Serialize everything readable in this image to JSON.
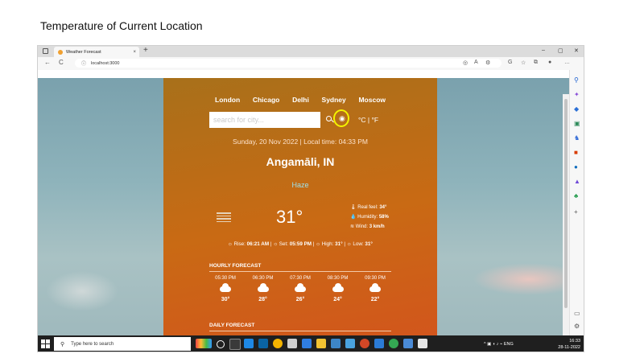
{
  "slide": {
    "title": "Temperature of Current Location"
  },
  "browser": {
    "tab_title": "Weather Forecast",
    "tab_close": "×",
    "new_tab": "+",
    "win_minimize": "–",
    "win_restore": "▢",
    "win_close": "✕",
    "url": "localhost:3000",
    "back": "←",
    "reload": "C",
    "info": "ⓘ"
  },
  "app": {
    "cities": [
      "London",
      "Chicago",
      "Delhi",
      "Sydney",
      "Moscow"
    ],
    "search_placeholder": "search for city...",
    "units": "°C | °F",
    "datetime": "Sunday, 20 Nov 2022 | Local time: 04:33 PM",
    "city": "Angamāli, IN",
    "condition": "Haze",
    "temperature": "31°",
    "details": {
      "real_feel_label": "Real feel:",
      "real_feel": "34°",
      "humidity_label": "Humidity:",
      "humidity": "58%",
      "wind_label": "Wind:",
      "wind": "3 km/h"
    },
    "sun": {
      "rise_label": "Rise:",
      "rise": "06:21 AM",
      "set_label": "Set:",
      "set": "05:59 PM",
      "high_label": "High:",
      "high": "31°",
      "low_label": "Low:",
      "low": "31°"
    },
    "hourly_title": "HOURLY FORECAST",
    "hourly": [
      {
        "time": "05:30 PM",
        "temp": "30°",
        "icon": "cloud-icon"
      },
      {
        "time": "06:30 PM",
        "temp": "28°",
        "icon": "cloud-icon"
      },
      {
        "time": "07:30 PM",
        "temp": "26°",
        "icon": "partly-cloudy-night-icon"
      },
      {
        "time": "08:30 PM",
        "temp": "24°",
        "icon": "partly-cloudy-night-icon"
      },
      {
        "time": "09:30 PM",
        "temp": "22°",
        "icon": "partly-cloudy-night-icon"
      }
    ],
    "daily_title": "DAILY FORECAST"
  },
  "taskbar": {
    "search_placeholder": "Type here to search",
    "lang": "ENG",
    "time": "16:33",
    "date": "28-11-2022"
  },
  "colors": {
    "app_gradient_start": "#a8701a",
    "app_gradient_end": "#d2561c",
    "highlight_ring": "#f4f400",
    "condition_text": "#9fe0e8"
  }
}
